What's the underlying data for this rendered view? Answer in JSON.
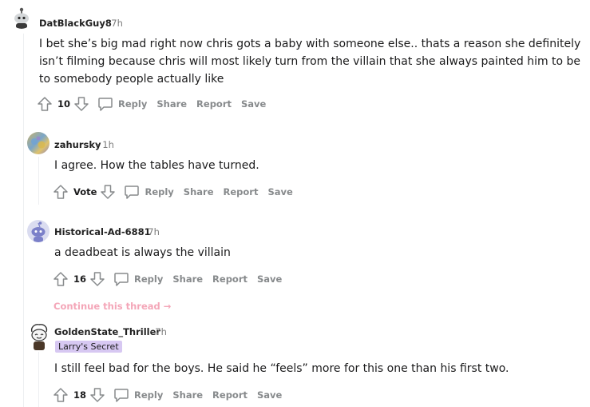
{
  "comments": [
    {
      "username": "DatBlackGuy8",
      "time": "· 7h",
      "body": "I bet she’s big mad right now chris gots a baby with someone else.. thats a reason she definitely isn’t filming because chris will most likely turn from the villain that she always painted him to be to somebody people actually like",
      "votes": "10"
    },
    {
      "username": "zahursky",
      "time": "· 1h",
      "body": "I agree. How the tables have turned.",
      "votes": "Vote"
    },
    {
      "username": "Historical-Ad-6881",
      "time": "· 7h",
      "body": "a deadbeat is always the villain",
      "votes": "16"
    },
    {
      "username": "GoldenState_Thriller",
      "time": "· 7h",
      "flair": "Larry's Secret",
      "body": "I still feel bad for the boys. He said he “feels” more for this one than his first two.",
      "votes": "18"
    }
  ],
  "actions": {
    "reply": "Reply",
    "share": "Share",
    "report": "Report",
    "save": "Save"
  },
  "continue_thread": "Continue this thread",
  "continue_arrow": "→",
  "colors": {
    "action_gray": "#878a8c",
    "flair_bg": "#d7c8f2",
    "continue_link": "#f4a6b8",
    "thread_line": "#edeff1"
  }
}
